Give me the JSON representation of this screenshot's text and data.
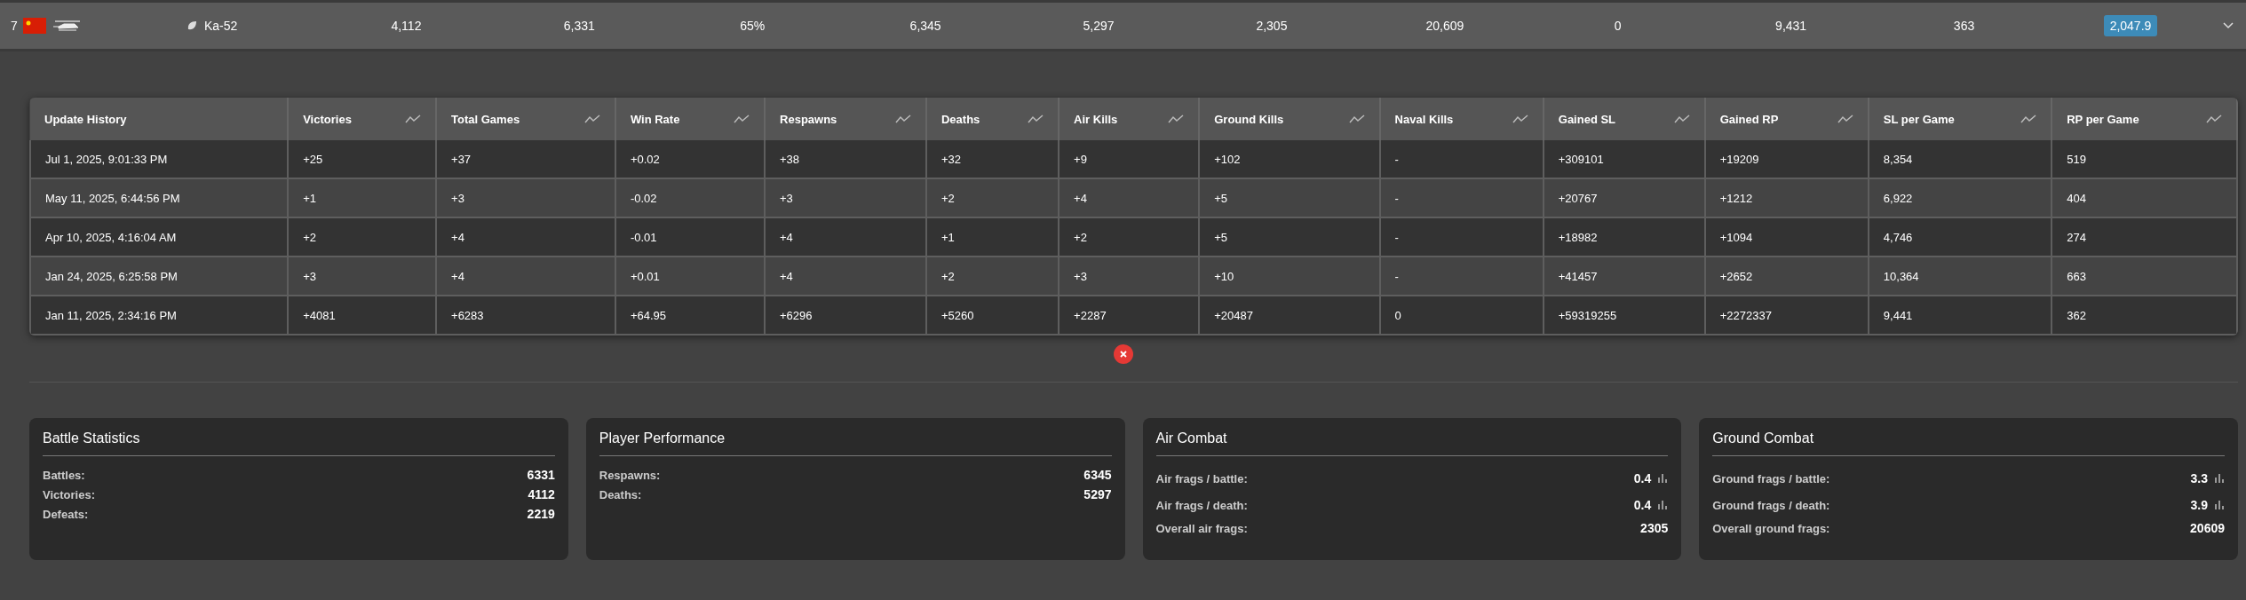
{
  "vehicle_row": {
    "rank": "7",
    "name": "Ka-52",
    "values": [
      "4,112",
      "6,331",
      "65%",
      "6,345",
      "5,297",
      "2,305",
      "20,609",
      "0",
      "9,431",
      "363"
    ],
    "highlight": "2,047.9",
    "expanded": true
  },
  "history_table": {
    "columns": [
      {
        "label": "Update History",
        "trend": false
      },
      {
        "label": "Victories",
        "trend": true
      },
      {
        "label": "Total Games",
        "trend": true
      },
      {
        "label": "Win Rate",
        "trend": true
      },
      {
        "label": "Respawns",
        "trend": true
      },
      {
        "label": "Deaths",
        "trend": true
      },
      {
        "label": "Air Kills",
        "trend": true
      },
      {
        "label": "Ground Kills",
        "trend": true
      },
      {
        "label": "Naval Kills",
        "trend": true
      },
      {
        "label": "Gained SL",
        "trend": true
      },
      {
        "label": "Gained RP",
        "trend": true
      },
      {
        "label": "SL per Game",
        "trend": true
      },
      {
        "label": "RP per Game",
        "trend": true
      }
    ],
    "rows": [
      [
        "Jul 1, 2025, 9:01:33 PM",
        "+25",
        "+37",
        "+0.02",
        "+38",
        "+32",
        "+9",
        "+102",
        "-",
        "+309101",
        "+19209",
        "8,354",
        "519"
      ],
      [
        "May 11, 2025, 6:44:56 PM",
        "+1",
        "+3",
        "-0.02",
        "+3",
        "+2",
        "+4",
        "+5",
        "-",
        "+20767",
        "+1212",
        "6,922",
        "404"
      ],
      [
        "Apr 10, 2025, 4:16:04 AM",
        "+2",
        "+4",
        "-0.01",
        "+4",
        "+1",
        "+2",
        "+5",
        "-",
        "+18982",
        "+1094",
        "4,746",
        "274"
      ],
      [
        "Jan 24, 2025, 6:25:58 PM",
        "+3",
        "+4",
        "+0.01",
        "+4",
        "+2",
        "+3",
        "+10",
        "-",
        "+41457",
        "+2652",
        "10,364",
        "663"
      ],
      [
        "Jan 11, 2025, 2:34:16 PM",
        "+4081",
        "+6283",
        "+64.95",
        "+6296",
        "+5260",
        "+2287",
        "+20487",
        "0",
        "+59319255",
        "+2272337",
        "9,441",
        "362"
      ]
    ]
  },
  "cards": [
    {
      "title": "Battle Statistics",
      "stats": [
        {
          "label": "Battles:",
          "value": "6331",
          "chart": false
        },
        {
          "label": "Victories:",
          "value": "4112",
          "chart": false
        },
        {
          "label": "Defeats:",
          "value": "2219",
          "chart": false
        }
      ]
    },
    {
      "title": "Player Performance",
      "stats": [
        {
          "label": "Respawns:",
          "value": "6345",
          "chart": false
        },
        {
          "label": "Deaths:",
          "value": "5297",
          "chart": false
        }
      ]
    },
    {
      "title": "Air Combat",
      "stats": [
        {
          "label": "Air frags / battle:",
          "value": "0.4",
          "chart": true
        },
        {
          "label": "Air frags / death:",
          "value": "0.4",
          "chart": true
        },
        {
          "label": "Overall air frags:",
          "value": "2305",
          "chart": false
        }
      ]
    },
    {
      "title": "Ground Combat",
      "stats": [
        {
          "label": "Ground frags / battle:",
          "value": "3.3",
          "chart": true
        },
        {
          "label": "Ground frags / death:",
          "value": "3.9",
          "chart": true
        },
        {
          "label": "Overall ground frags:",
          "value": "20609",
          "chart": false
        }
      ]
    }
  ]
}
